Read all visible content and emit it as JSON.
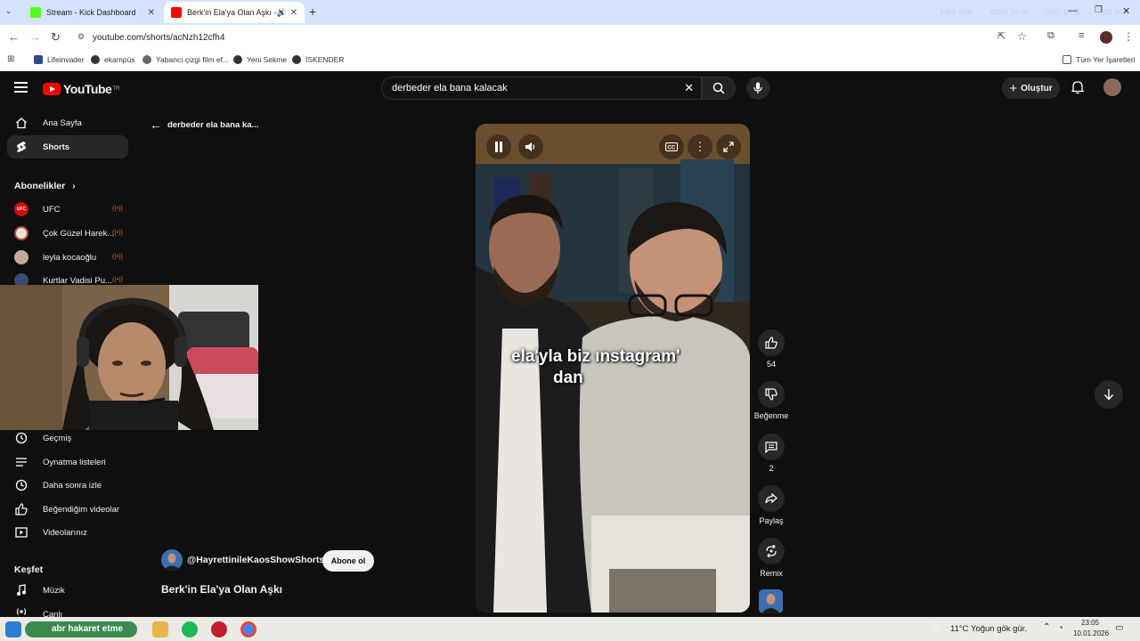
{
  "browser": {
    "tabs": [
      {
        "title": "Stream - Kick Dashboard",
        "active": false
      },
      {
        "title": "Berk'in Ela'ya Olan Aşkı - Yo",
        "active": true
      }
    ],
    "new_tab_icon": "plus-icon",
    "sysmon": {
      "fps_label": "FPS",
      "fps_value": "N/A",
      "gpu_label": "GPU",
      "gpu_value": "16 %",
      "cpu_label": "CPU",
      "cpu_value": "14 %",
      "lat_label": "LAT",
      "lat_value": "N/A"
    },
    "url": "youtube.com/shorts/acNzh12cfh4",
    "bookmarks": [
      "Lifeinvader",
      "ekampüs",
      "Yabancı çizgi film ef...",
      "Yeni Sekme",
      "İSKENDER"
    ],
    "all_bookmarks": "Tüm Yer İşaretleri"
  },
  "youtube": {
    "logo_text": "YouTube",
    "logo_region": "TR",
    "search_query": "derbeder ela bana kalacak",
    "create_label": "Oluştur",
    "guide": {
      "home": "Ana Sayfa",
      "shorts": "Shorts",
      "subscriptions_header": "Abonelikler",
      "subscriptions": [
        "UFC",
        "Çok Güzel Harek...",
        "leyla kocaoğlu",
        "Kurtlar Vadisi Pu..."
      ],
      "history": "Geçmiş",
      "playlists": "Oynatma listeleri",
      "watch_later": "Daha sonra izle",
      "liked": "Beğendiğim videolar",
      "your_videos": "Videolarınız",
      "explore_header": "Keşfet",
      "music": "Müzik",
      "live": "Canlı"
    },
    "back_label": "derbeder ela bana ka...",
    "caption_line1": "ela'yla biz ınstagram'",
    "caption_line2": "dan",
    "actions": {
      "like_count": "54",
      "dislike_label": "Beğenme",
      "comment_count": "2",
      "share_label": "Paylaş",
      "remix_label": "Remix"
    },
    "channel_handle": "@HayrettinileKaosShowShorts",
    "subscribe_label": "Abone ol",
    "video_title": "Berk'in Ela'ya Olan Aşkı"
  },
  "taskbar": {
    "search_text": "abr hakaret etme",
    "weather": "11°C  Yoğun gök gür.",
    "time": "23:05",
    "date": "10.01.2026"
  },
  "colors": {
    "yt_red": "#ff0000",
    "bg": "#0f0f0f",
    "tab_strip": "#d3e3fd"
  }
}
